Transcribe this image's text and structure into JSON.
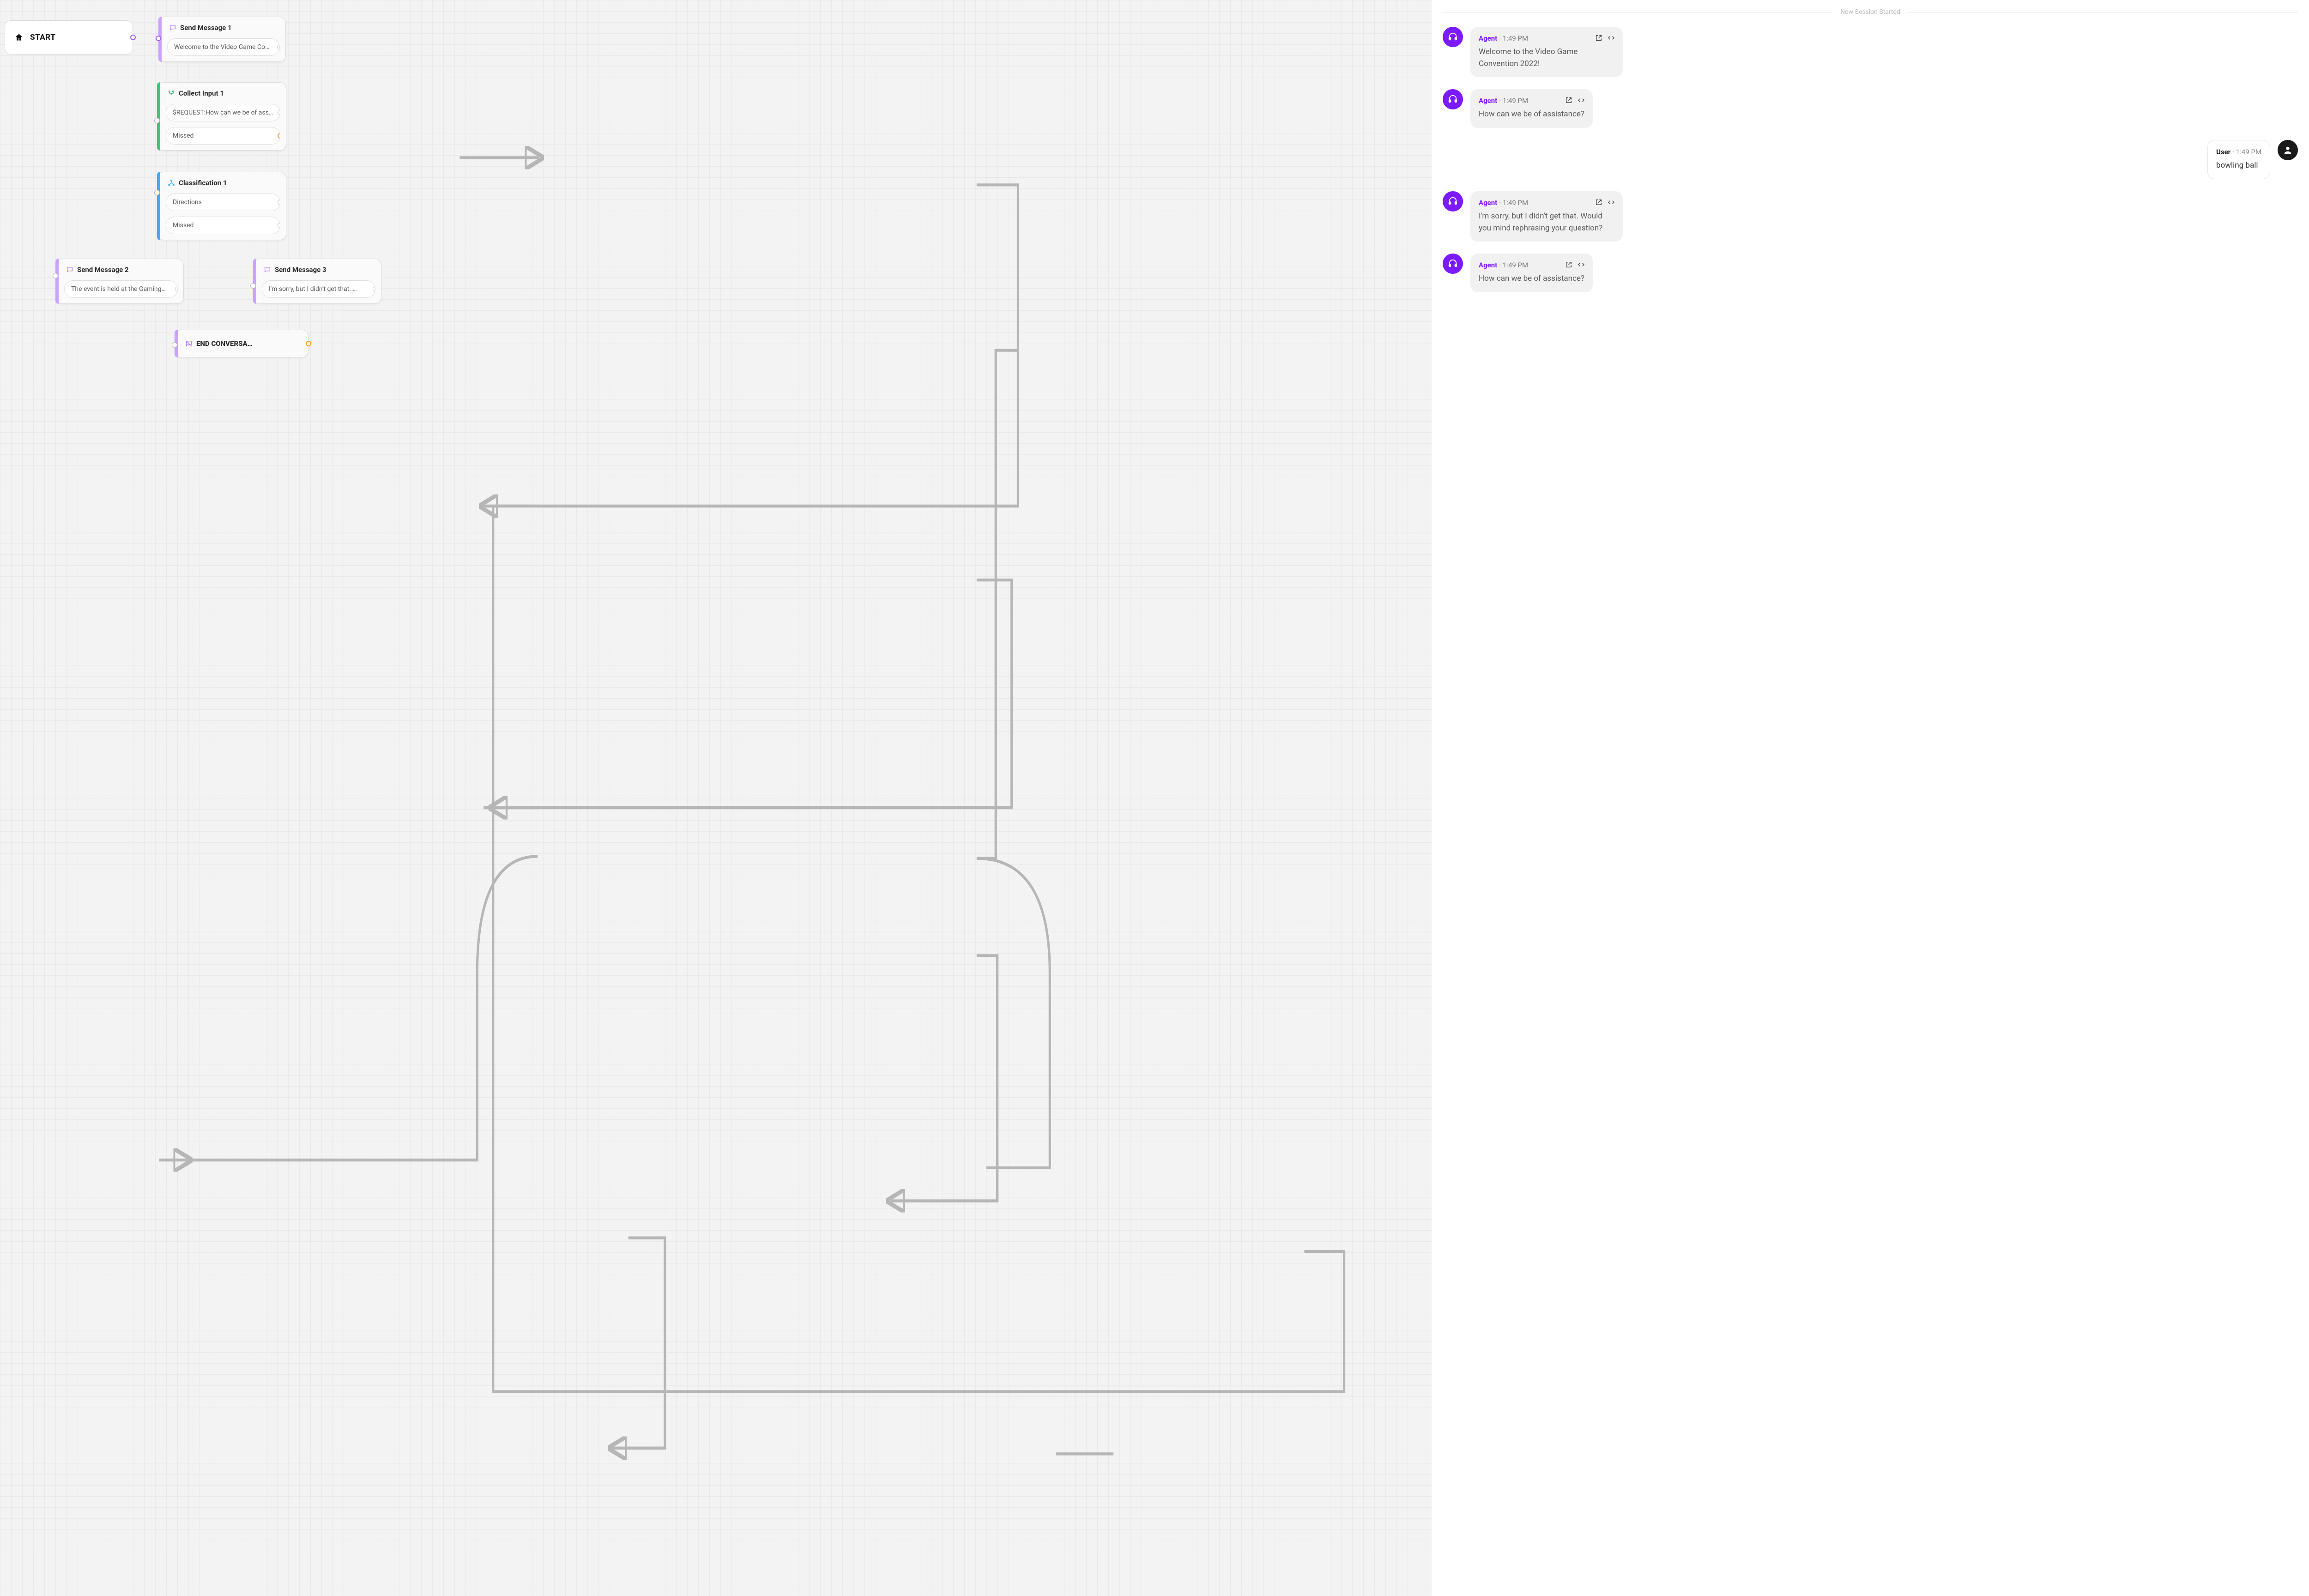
{
  "canvas": {
    "start": {
      "label": "START"
    },
    "nodes": {
      "sm1": {
        "title": "Send Message 1",
        "slot": "Welcome to the Video Game Co…"
      },
      "ci1": {
        "title": "Collect Input 1",
        "slots": [
          "$REQUEST:How can we be of assis…",
          "Missed"
        ]
      },
      "cl1": {
        "title": "Classification 1",
        "slots": [
          "Directions",
          "Missed"
        ]
      },
      "sm2": {
        "title": "Send Message 2",
        "slot": "The event is held at the Gaming…"
      },
      "sm3": {
        "title": "Send Message 3",
        "slot": "I'm sorry, but I didn't get that. …"
      },
      "end": {
        "title": "END CONVERSA…"
      }
    }
  },
  "chat": {
    "divider": "New Session Started",
    "messages": [
      {
        "from": "agent",
        "name": "Agent",
        "time": "1:49 PM",
        "body": "Welcome to the Video Game Convention 2022!"
      },
      {
        "from": "agent",
        "name": "Agent",
        "time": "1:49 PM",
        "body": "How can we be of assistance?"
      },
      {
        "from": "user",
        "name": "User",
        "time": "1:49 PM",
        "body": "bowling ball"
      },
      {
        "from": "agent",
        "name": "Agent",
        "time": "1:49 PM",
        "body": "I'm sorry, but I didn't get that. Would you mind rephrasing your question?"
      },
      {
        "from": "agent",
        "name": "Agent",
        "time": "1:49 PM",
        "body": "How can we be of assistance?"
      }
    ]
  }
}
